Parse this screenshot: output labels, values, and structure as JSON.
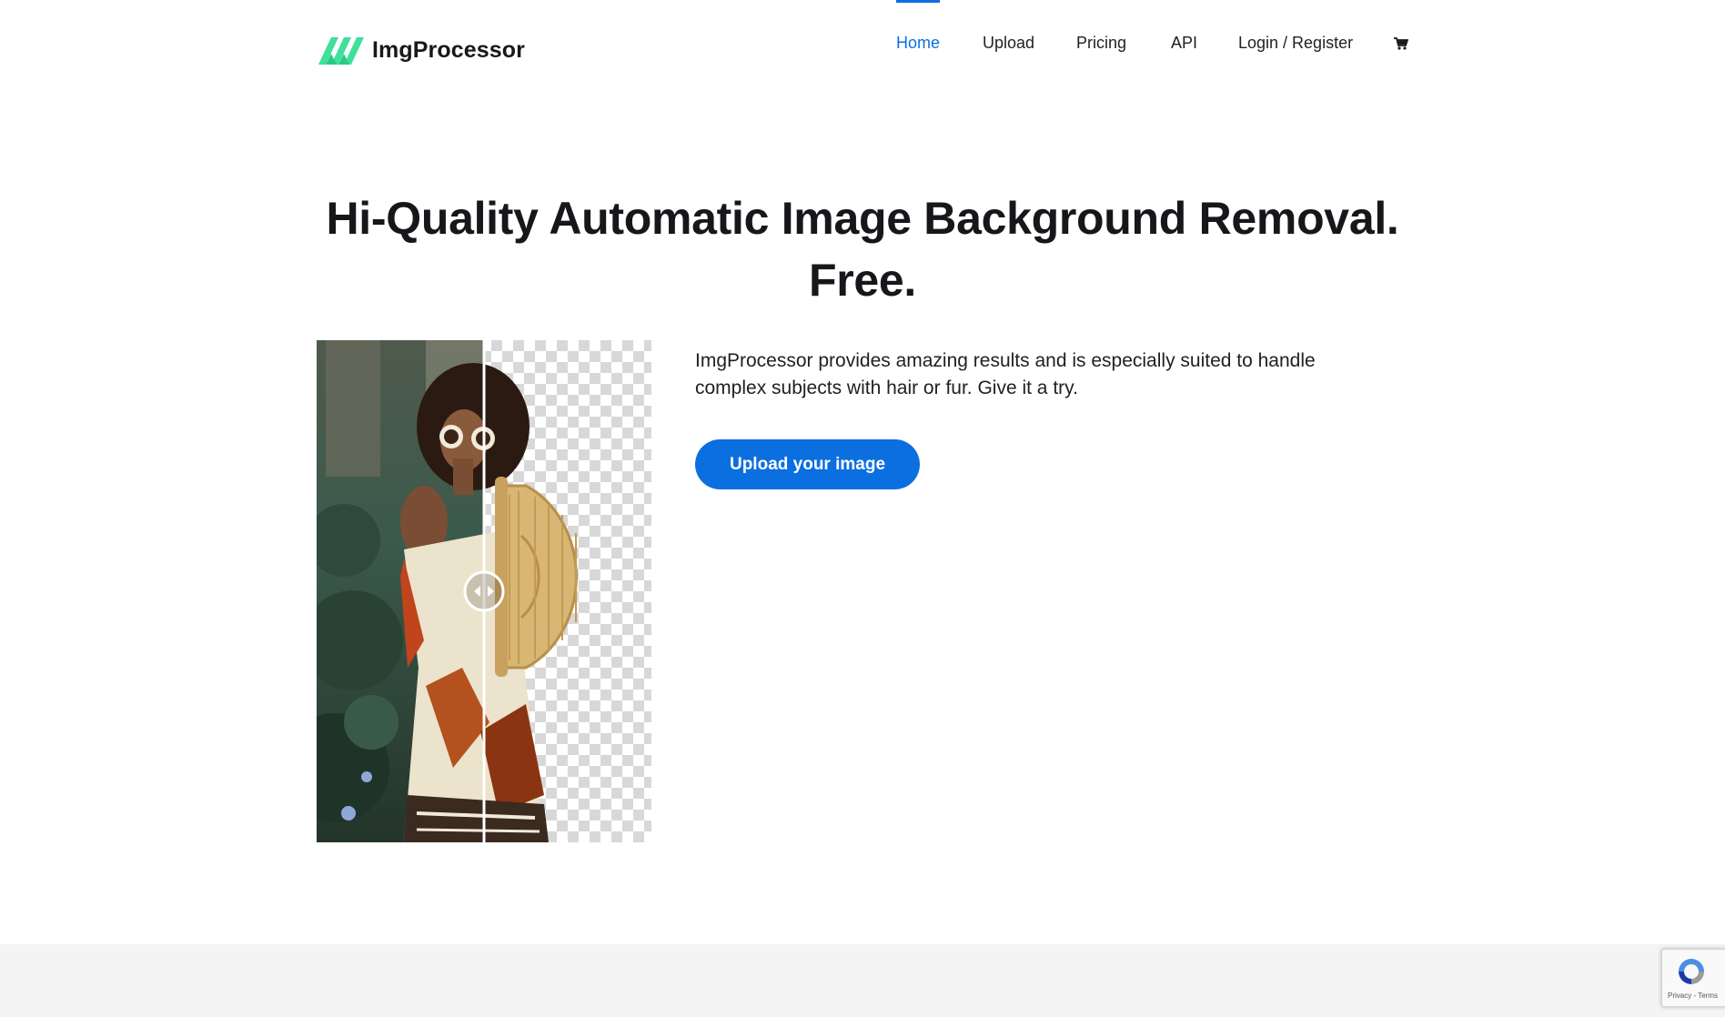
{
  "brand": {
    "name": "ImgProcessor",
    "logo_color": "#3ee09a"
  },
  "nav": {
    "items": [
      {
        "label": "Home",
        "active": true
      },
      {
        "label": "Upload",
        "active": false
      },
      {
        "label": "Pricing",
        "active": false
      },
      {
        "label": "API",
        "active": false
      },
      {
        "label": "Login / Register",
        "active": false
      }
    ],
    "cart_icon": "shopping-cart-icon",
    "accent_color": "#0b6fe0"
  },
  "hero": {
    "headline_line1": "Hi-Quality Automatic Image Background Removal.",
    "headline_line2": "Free.",
    "description": "ImgProcessor provides amazing results and is especially suited to handle complex subjects with hair or fur. Give it a try.",
    "cta_label": "Upload your image",
    "comparison": {
      "divider_icon": "left-right-arrows-icon",
      "split_position": 0.5
    }
  },
  "recaptcha": {
    "icon": "recaptcha-logo-icon",
    "links": "Privacy - Terms"
  }
}
